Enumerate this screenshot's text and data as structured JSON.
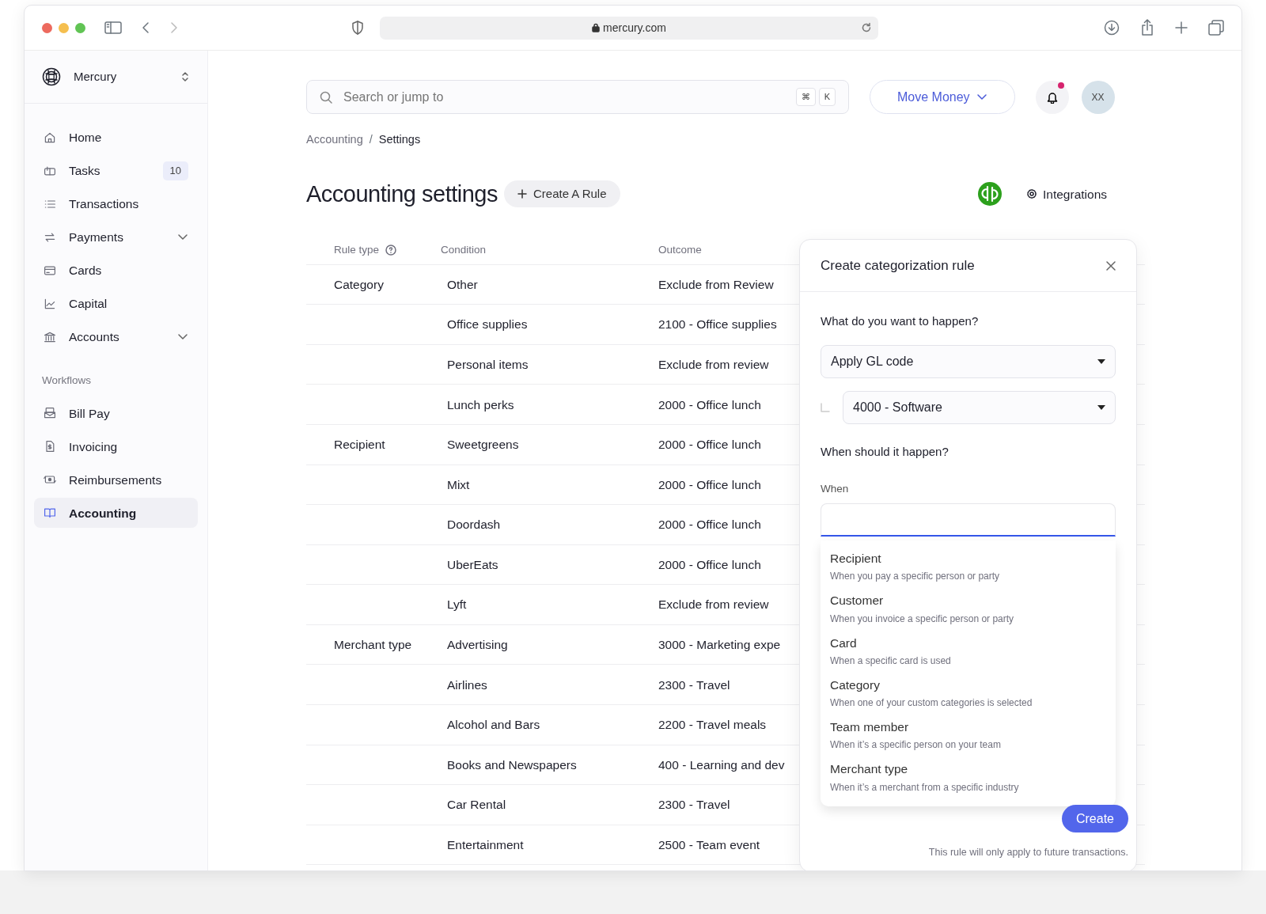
{
  "browser": {
    "url": "mercury.com"
  },
  "sidebar": {
    "org": "Mercury",
    "items": [
      {
        "label": "Home",
        "selected": false
      },
      {
        "label": "Tasks",
        "badge": "10",
        "selected": false
      },
      {
        "label": "Transactions",
        "selected": false
      },
      {
        "label": "Payments",
        "expandable": true,
        "selected": false
      },
      {
        "label": "Cards",
        "selected": false
      },
      {
        "label": "Capital",
        "selected": false
      },
      {
        "label": "Accounts",
        "expandable": true,
        "selected": false
      }
    ],
    "section": "Workflows",
    "workflow_items": [
      {
        "label": "Bill Pay",
        "selected": false
      },
      {
        "label": "Invoicing",
        "selected": false
      },
      {
        "label": "Reimbursements",
        "selected": false
      },
      {
        "label": "Accounting",
        "selected": true
      }
    ]
  },
  "search": {
    "placeholder": "Search or jump to",
    "shortcut": [
      "⌘",
      "K"
    ]
  },
  "move_money": "Move Money",
  "notifications": {
    "unread": true
  },
  "avatar": "XX",
  "breadcrumb": {
    "items": [
      "Accounting",
      "Settings"
    ],
    "separator": "/"
  },
  "title": "Accounting settings",
  "create_rule": "Create A Rule",
  "integrations": "Integrations",
  "table": {
    "columns": [
      "Rule type",
      "Condition",
      "Outcome"
    ],
    "rows": [
      {
        "rule_type": "Category",
        "condition": "Other",
        "outcome": "Exclude from Review"
      },
      {
        "condition": "Office supplies",
        "outcome": "2100 -  Office supplies"
      },
      {
        "condition": "Personal items",
        "outcome": "Exclude from review"
      },
      {
        "condition": "Lunch perks",
        "outcome": "2000 - Office lunch"
      },
      {
        "rule_type": "Recipient",
        "condition": "Sweetgreens",
        "outcome": "2000 - Office lunch"
      },
      {
        "condition": "Mixt",
        "outcome": "2000 - Office lunch"
      },
      {
        "condition": "Doordash",
        "outcome": "2000 - Office lunch"
      },
      {
        "condition": "UberEats",
        "outcome": "2000 - Office lunch"
      },
      {
        "condition": "Lyft",
        "outcome": "Exclude from review"
      },
      {
        "rule_type": "Merchant type",
        "condition": "Advertising",
        "outcome": "3000 - Marketing expe"
      },
      {
        "condition": "Airlines",
        "outcome": "2300 - Travel"
      },
      {
        "condition": "Alcohol and Bars",
        "outcome": "2200 - Travel meals"
      },
      {
        "condition": "Books and Newspapers",
        "outcome": "400 - Learning and dev"
      },
      {
        "condition": "Car Rental",
        "outcome": "2300 - Travel"
      },
      {
        "condition": "Entertainment",
        "outcome": "2500 - Team event"
      }
    ]
  },
  "modal": {
    "title": "Create categorization rule",
    "question_1": "What do you want to happen?",
    "action": "Apply GL code",
    "gl_code": "4000 - Software",
    "question_2": "When should it happen?",
    "when_label": "When",
    "options": [
      {
        "label": "Recipient",
        "description": "When you pay a specific person or party"
      },
      {
        "label": "Customer",
        "description": "When you invoice a specific person or party"
      },
      {
        "label": "Card",
        "description": "When a specific card is used"
      },
      {
        "label": "Category",
        "description": "When one of your custom categories is selected"
      },
      {
        "label": "Team member",
        "description": "When it’s a specific person on your team"
      },
      {
        "label": "Merchant type",
        "description": "When it’s a merchant from a specific industry"
      }
    ],
    "create": "Create",
    "note": "This rule will only apply to future transactions."
  }
}
